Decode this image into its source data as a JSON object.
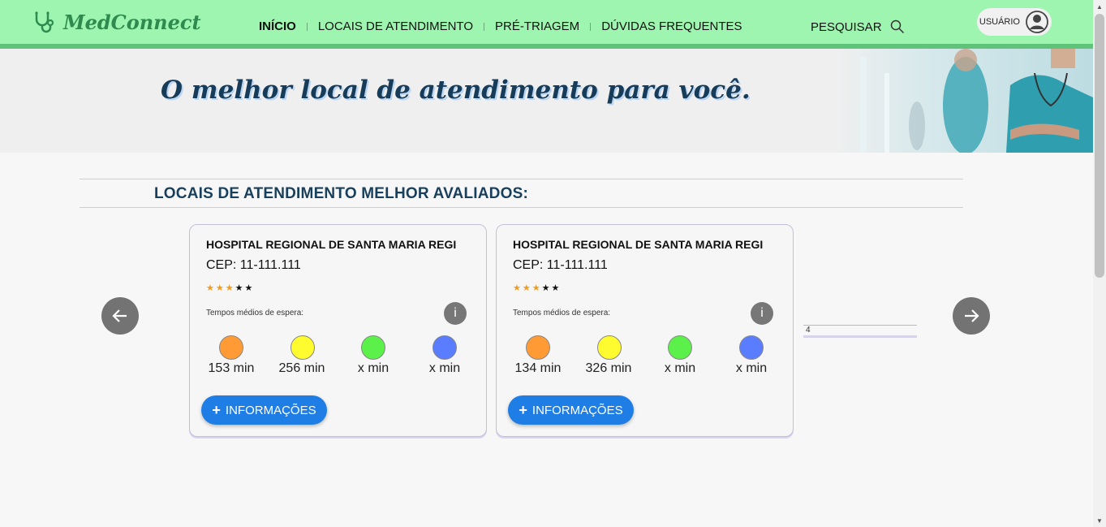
{
  "header": {
    "logo_text": "MedConnect",
    "nav": [
      {
        "label": "INÍCIO",
        "active": true
      },
      {
        "label": "LOCAIS DE ATENDIMENTO",
        "active": false
      },
      {
        "label": "PRÉ-TRIAGEM",
        "active": false
      },
      {
        "label": "DÚVIDAS FREQUENTES",
        "active": false
      }
    ],
    "search_label": "PESQUISAR",
    "user_label": "USUÁRIO"
  },
  "banner": {
    "title": "O melhor local de atendimento para você."
  },
  "section": {
    "title": "LOCAIS DE ATENDIMENTO MELHOR AVALIADOS:"
  },
  "cards": [
    {
      "name": "HOSPITAL REGIONAL DE SANTA MARIA REGI",
      "cep": "CEP: 11-111.111",
      "rating": 3,
      "wait_label": "Tempos médios de espera:",
      "info_glyph": "i",
      "waits": [
        "153 min",
        "256 min",
        "x min",
        "x min"
      ],
      "button_plus": "+",
      "button_label": "INFORMAÇÕES"
    },
    {
      "name": "HOSPITAL REGIONAL DE SANTA MARIA REGI",
      "cep": "CEP: 11-111.111",
      "rating": 3,
      "wait_label": "Tempos médios de espera:",
      "info_glyph": "i",
      "waits": [
        "134 min",
        "326 min",
        "x min",
        "x min"
      ],
      "button_plus": "+",
      "button_label": "INFORMAÇÕES"
    }
  ],
  "partial_card_text": "4",
  "wait_colors": [
    "#ff9a35",
    "#fffb2e",
    "#5cf04a",
    "#5a7cff"
  ],
  "icons": {
    "logo": "stethoscope-icon",
    "search": "search-icon",
    "user": "user-avatar-icon",
    "prev": "arrow-left-icon",
    "next": "arrow-right-icon"
  }
}
